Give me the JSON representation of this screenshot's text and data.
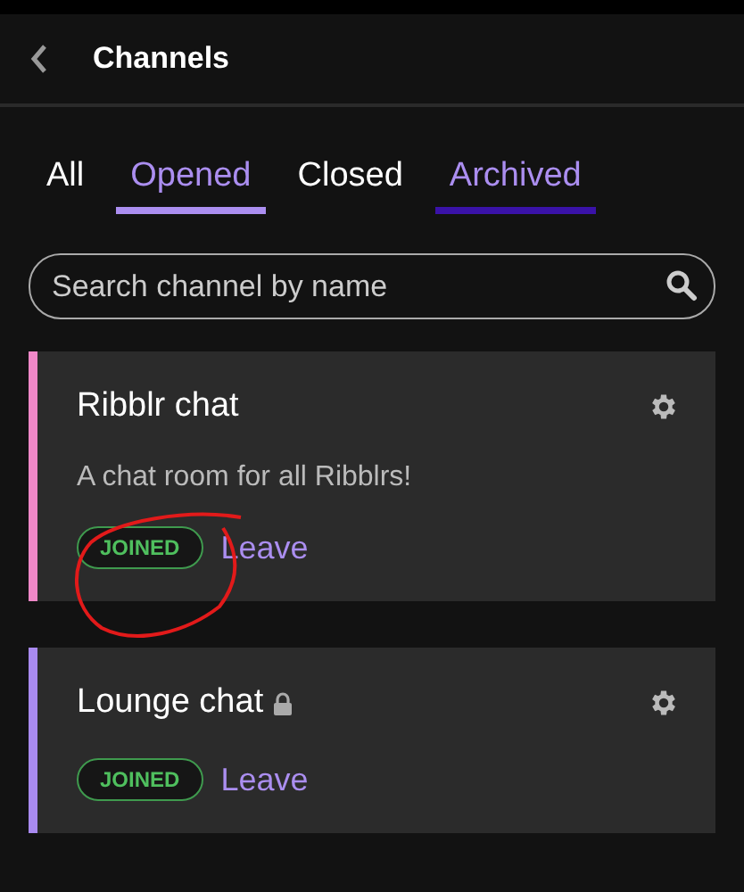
{
  "header": {
    "title": "Channels"
  },
  "tabs": [
    {
      "label": "All",
      "selected": false,
      "focused": false
    },
    {
      "label": "Opened",
      "selected": true,
      "focused": false
    },
    {
      "label": "Closed",
      "selected": false,
      "focused": false
    },
    {
      "label": "Archived",
      "selected": false,
      "focused": true
    }
  ],
  "search": {
    "placeholder": "Search channel by name"
  },
  "channels": [
    {
      "name": "Ribblr chat",
      "locked": false,
      "description": "A chat room for all Ribblrs!",
      "badge": "JOINED",
      "action": "Leave",
      "color": "#f088c8",
      "circled": true
    },
    {
      "name": "Lounge chat",
      "locked": true,
      "badge": "JOINED",
      "action": "Leave",
      "color": "#a98af0",
      "circled": false
    }
  ]
}
